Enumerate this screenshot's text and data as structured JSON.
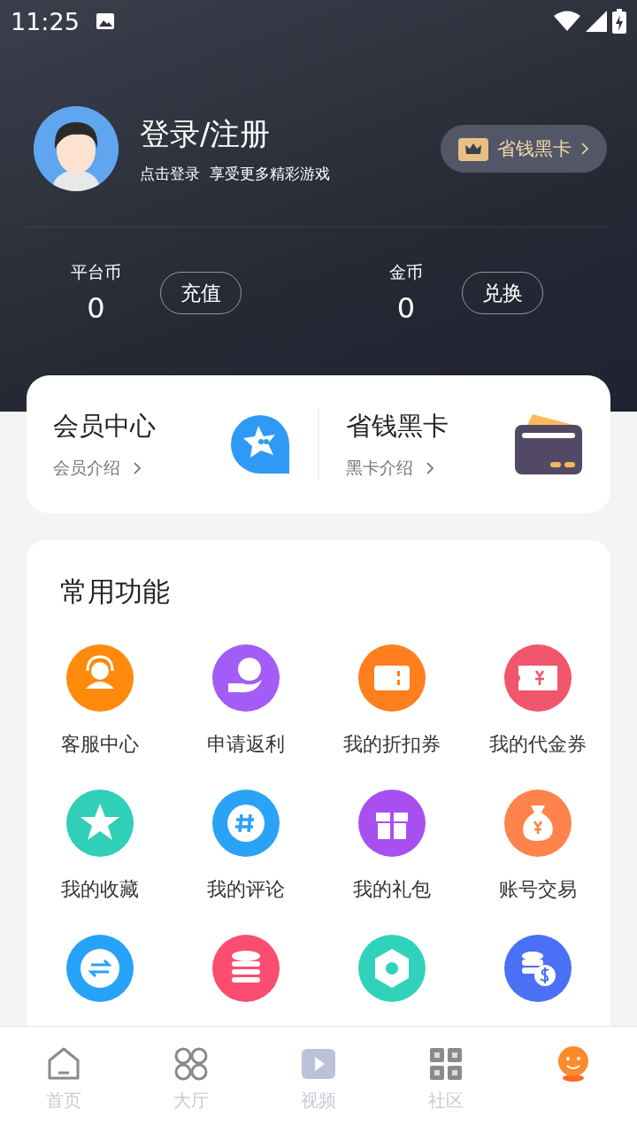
{
  "status_bar": {
    "time": "11:25"
  },
  "profile": {
    "title": "登录/注册",
    "subtitle": "点击登录  享受更多精彩游戏",
    "card_button": "省钱黑卡"
  },
  "wallets": [
    {
      "label": "平台币",
      "amount": "0",
      "action": "充值"
    },
    {
      "label": "金币",
      "amount": "0",
      "action": "兑换"
    }
  ],
  "member_card": [
    {
      "title": "会员中心",
      "link": "会员介绍"
    },
    {
      "title": "省钱黑卡",
      "link": "黑卡介绍"
    }
  ],
  "functions": {
    "title": "常用功能",
    "items": [
      {
        "label": "客服中心",
        "color": "#ff8a0c"
      },
      {
        "label": "申请返利",
        "color": "#a35cf6"
      },
      {
        "label": "我的折扣券",
        "color": "#ff7f1e"
      },
      {
        "label": "我的代金券",
        "color": "#f0566c"
      },
      {
        "label": "我的收藏",
        "color": "#2fcfb8"
      },
      {
        "label": "我的评论",
        "color": "#2aa3f7"
      },
      {
        "label": "我的礼包",
        "color": "#a74ff0"
      },
      {
        "label": "账号交易",
        "color": "#ff834a"
      },
      {
        "color": "#26a2f8"
      },
      {
        "color": "#fb4d72"
      },
      {
        "color": "#30d2b9"
      },
      {
        "color": "#4a70f5"
      }
    ]
  },
  "bottom_nav": [
    {
      "label": "首页",
      "selected": false
    },
    {
      "label": "大厅",
      "selected": false
    },
    {
      "label": "视频",
      "selected": false
    },
    {
      "label": "社区",
      "selected": false
    },
    {
      "selected": true
    }
  ]
}
